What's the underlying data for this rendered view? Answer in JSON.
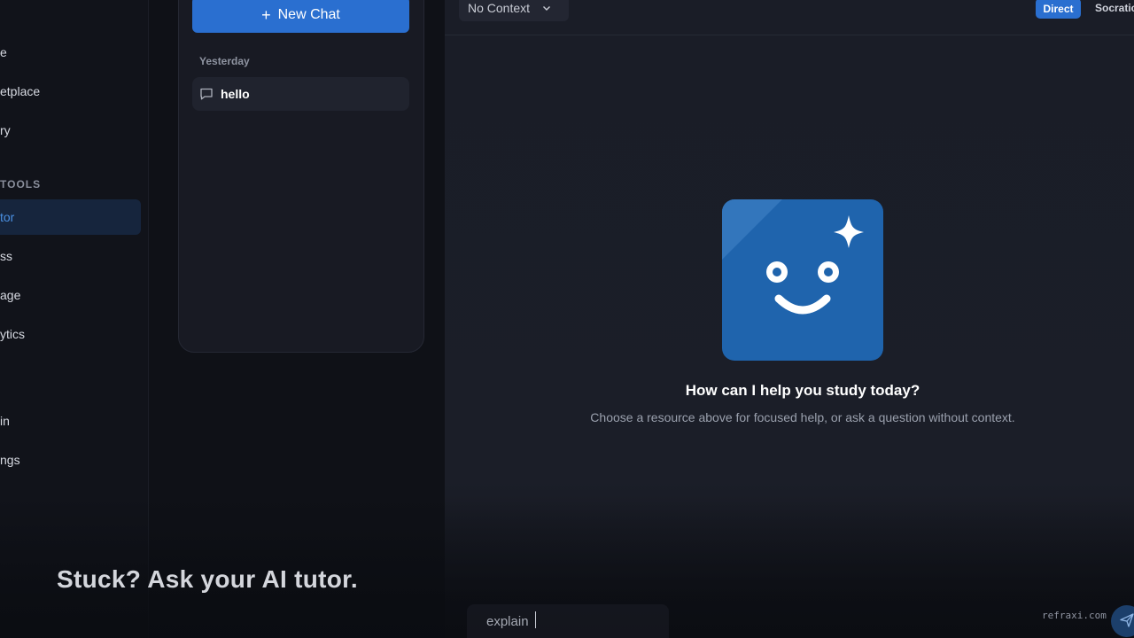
{
  "nav": {
    "items": [
      {
        "label": "e"
      },
      {
        "label": "etplace"
      },
      {
        "label": "ry"
      },
      {
        "label": "tor"
      },
      {
        "label": "ss"
      },
      {
        "label": "age"
      },
      {
        "label": "ytics"
      },
      {
        "label": "in"
      },
      {
        "label": "ngs"
      }
    ],
    "section_label": "TOOLS",
    "active_color": "#4a90e2"
  },
  "chat_list": {
    "new_chat_label": "New Chat",
    "group_label": "Yesterday",
    "items": [
      {
        "title": "hello"
      }
    ]
  },
  "topbar": {
    "context_selected": "No Context",
    "mode_direct": "Direct",
    "mode_socratic": "Socratic"
  },
  "main": {
    "welcome_title": "How can I help you study today?",
    "welcome_subtitle": "Choose a resource above for focused help, or ask a question without context."
  },
  "input": {
    "value": "explain"
  },
  "overlay": {
    "caption": "Stuck? Ask your AI tutor.",
    "watermark": "refraxi.com"
  },
  "colors": {
    "accent": "#2a6fd0",
    "mascot_bg": "#1f64ad"
  }
}
